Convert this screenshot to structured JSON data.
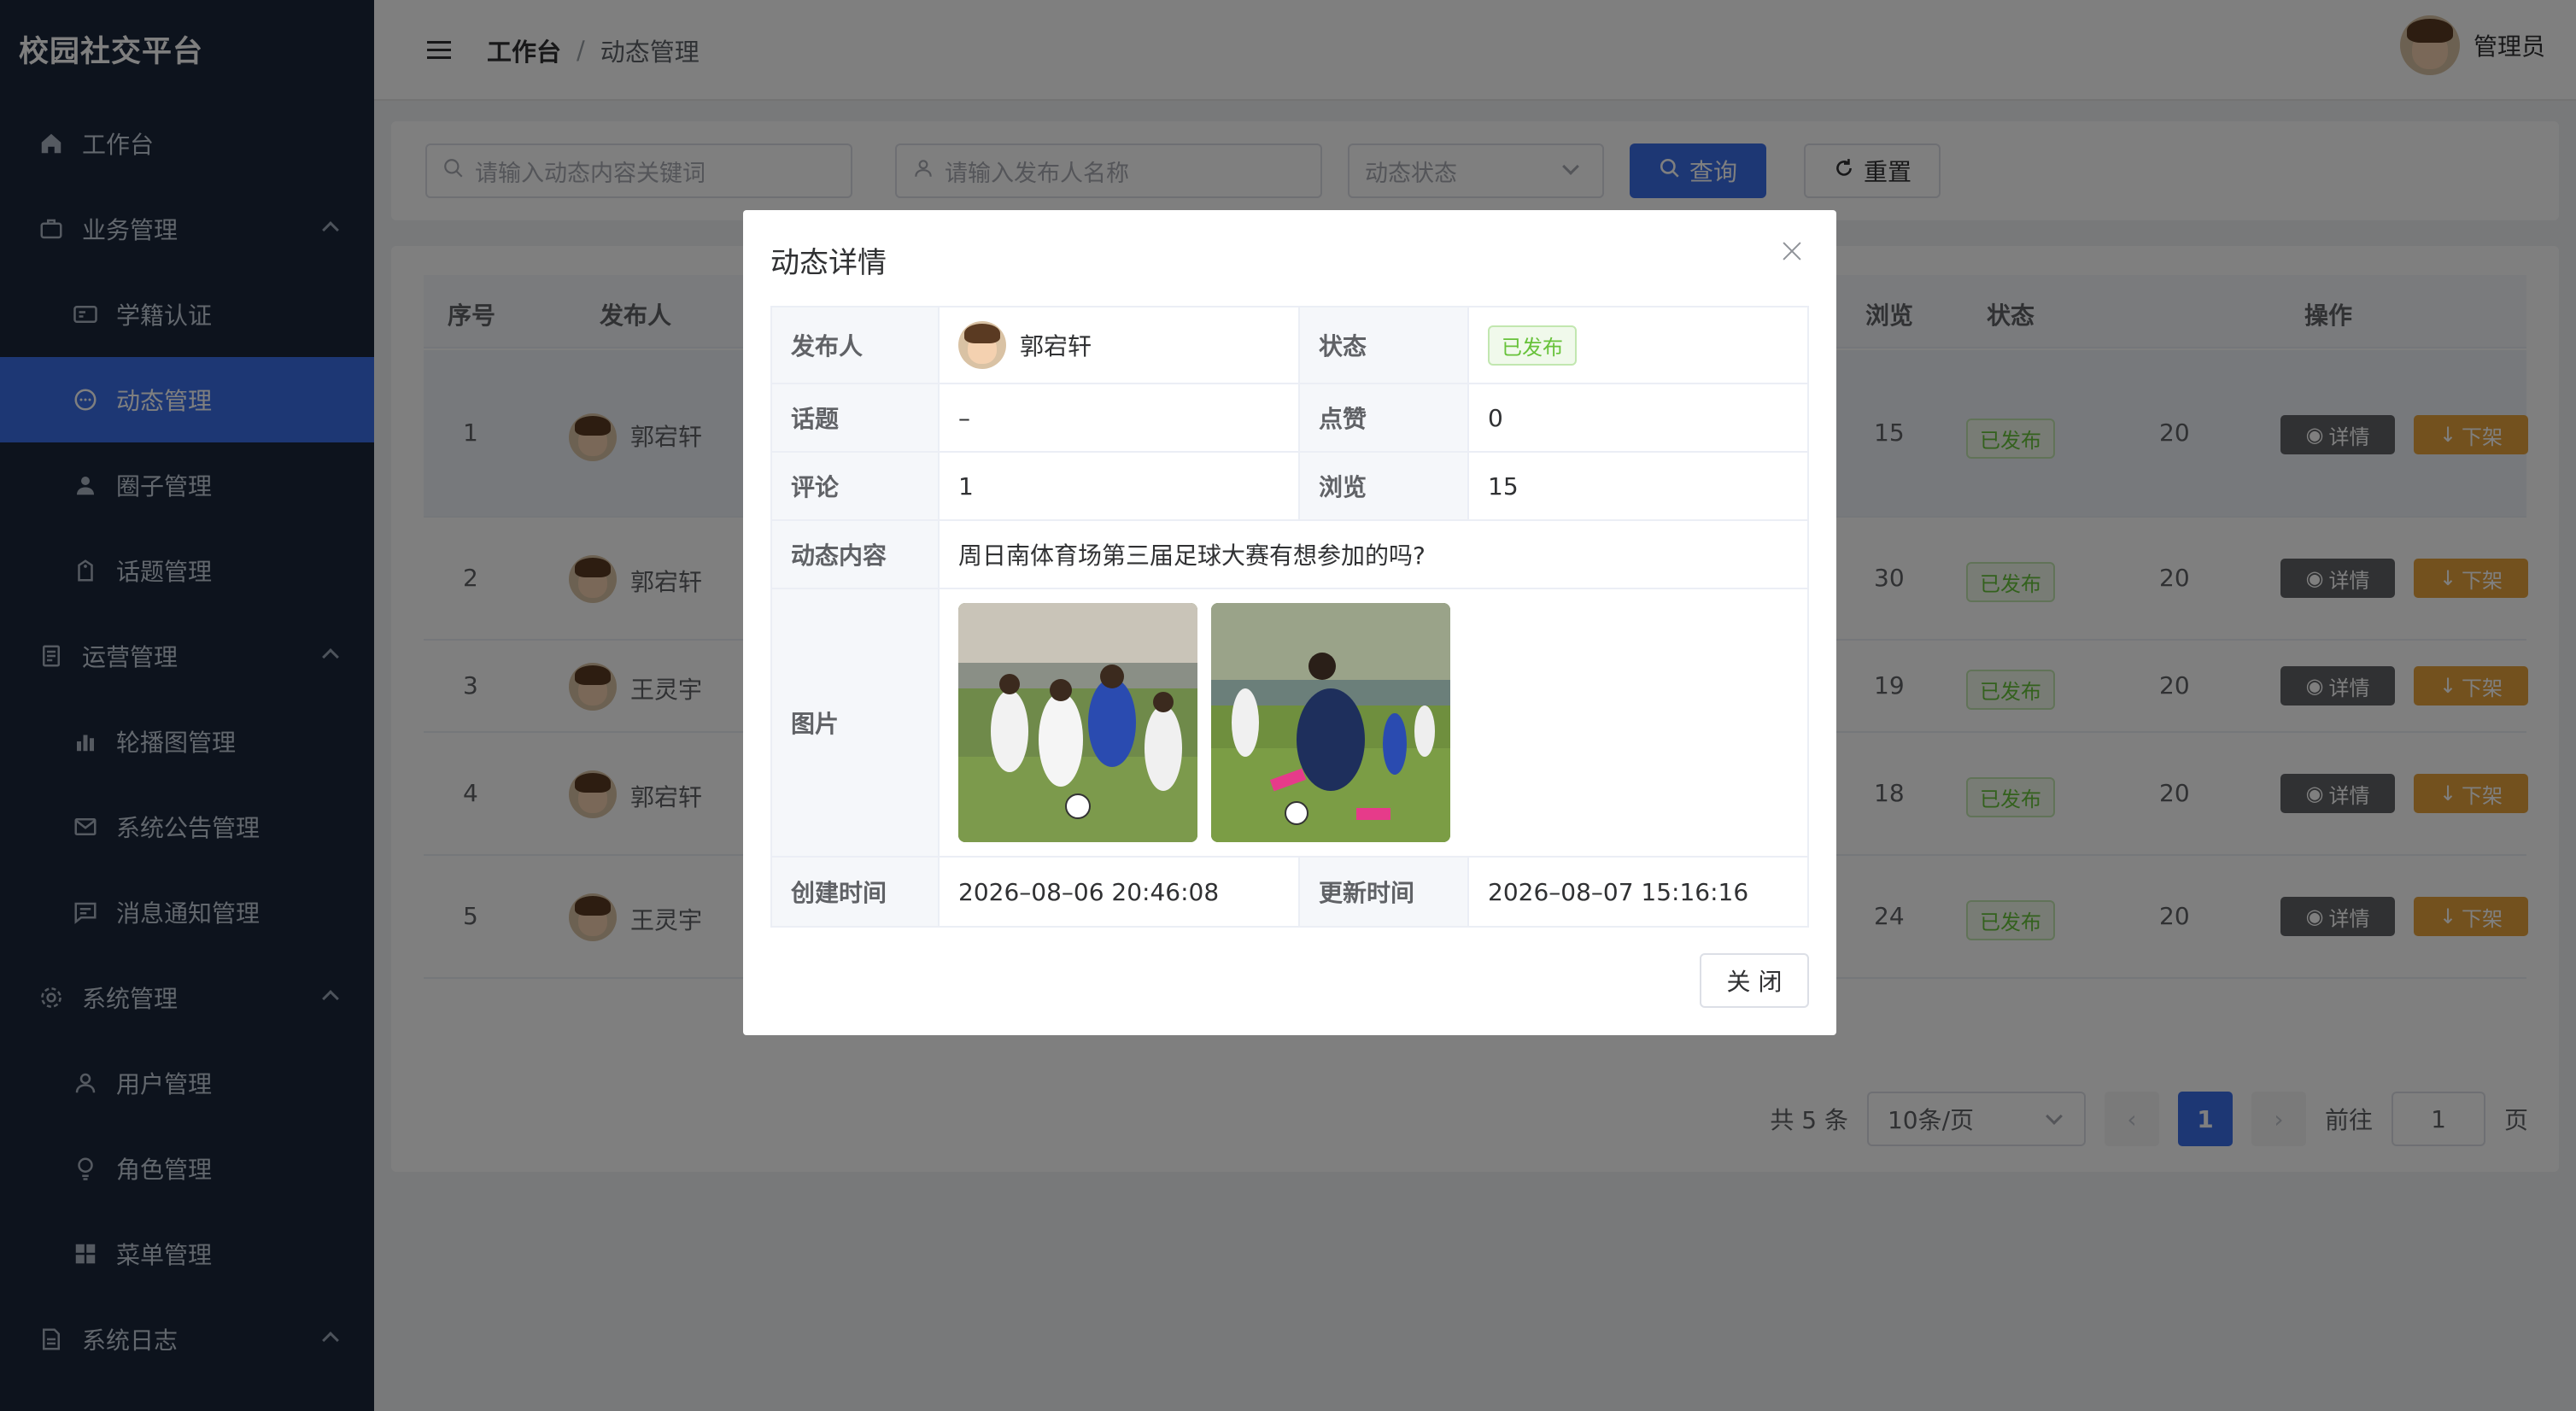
{
  "sidebar": {
    "logo": "校园社交平台",
    "items": [
      {
        "label": "工作台",
        "icon": "home-icon"
      },
      {
        "label": "业务管理",
        "icon": "briefcase-icon"
      },
      {
        "label": "学籍认证",
        "icon": "id-card-icon"
      },
      {
        "label": "动态管理",
        "icon": "chat-bubble-icon"
      },
      {
        "label": "圈子管理",
        "icon": "user-icon"
      },
      {
        "label": "话题管理",
        "icon": "tag-icon"
      },
      {
        "label": "运营管理",
        "icon": "document-icon"
      },
      {
        "label": "轮播图管理",
        "icon": "bar-chart-icon"
      },
      {
        "label": "系统公告管理",
        "icon": "mail-icon"
      },
      {
        "label": "消息通知管理",
        "icon": "message-icon"
      },
      {
        "label": "系统管理",
        "icon": "gear-icon"
      },
      {
        "label": "用户管理",
        "icon": "user-outline-icon"
      },
      {
        "label": "角色管理",
        "icon": "bulb-icon"
      },
      {
        "label": "菜单管理",
        "icon": "grid-icon"
      },
      {
        "label": "系统日志",
        "icon": "log-icon"
      }
    ]
  },
  "header": {
    "breadcrumb_home": "工作台",
    "breadcrumb_sep": "/",
    "breadcrumb_current": "动态管理",
    "user_name": "管理员"
  },
  "filters": {
    "content_placeholder": "请输入动态内容关键词",
    "publisher_placeholder": "请输入发布人名称",
    "status_placeholder": "动态状态",
    "query_label": "查询",
    "reset_label": "重置"
  },
  "table": {
    "headers": {
      "index": "序号",
      "publisher": "发布人",
      "views": "浏览",
      "status": "状态",
      "actions": "操作"
    },
    "rows": [
      {
        "index": "1",
        "publisher": "郭宕轩",
        "views": "15",
        "status": "已发布",
        "time": "20"
      },
      {
        "index": "2",
        "publisher": "郭宕轩",
        "views": "30",
        "status": "已发布",
        "time": "20"
      },
      {
        "index": "3",
        "publisher": "王灵宇",
        "views": "19",
        "status": "已发布",
        "time": "20"
      },
      {
        "index": "4",
        "publisher": "郭宕轩",
        "views": "18",
        "status": "已发布",
        "time": "20"
      },
      {
        "index": "5",
        "publisher": "王灵宇",
        "views": "24",
        "status": "已发布",
        "time": "20"
      }
    ],
    "detail_label": "详情",
    "offline_label": "下架"
  },
  "pagination": {
    "total": "共 5 条",
    "page_size": "10条/页",
    "current_page": "1",
    "goto_prefix": "前往",
    "goto_value": "1",
    "goto_suffix": "页"
  },
  "dialog": {
    "title": "动态详情",
    "publisher_label": "发布人",
    "publisher_value": "郭宕轩",
    "status_label": "状态",
    "status_value": "已发布",
    "topic_label": "话题",
    "topic_value": "–",
    "likes_label": "点赞",
    "likes_value": "0",
    "comments_label": "评论",
    "comments_value": "1",
    "views_label": "浏览",
    "views_value": "15",
    "content_label": "动态内容",
    "content_value": "周日南体育场第三届足球大赛有想参加的吗?",
    "images_label": "图片",
    "created_label": "创建时间",
    "created_value": "2026–08–06 20:46:08",
    "updated_label": "更新时间",
    "updated_value": "2026–08–07 15:16:16",
    "close_label": "关 闭"
  },
  "colors": {
    "primary": "#3a6ee8",
    "sidebar_bg": "#1b263b",
    "success": "#67c23a",
    "warning": "#e6a23c"
  }
}
